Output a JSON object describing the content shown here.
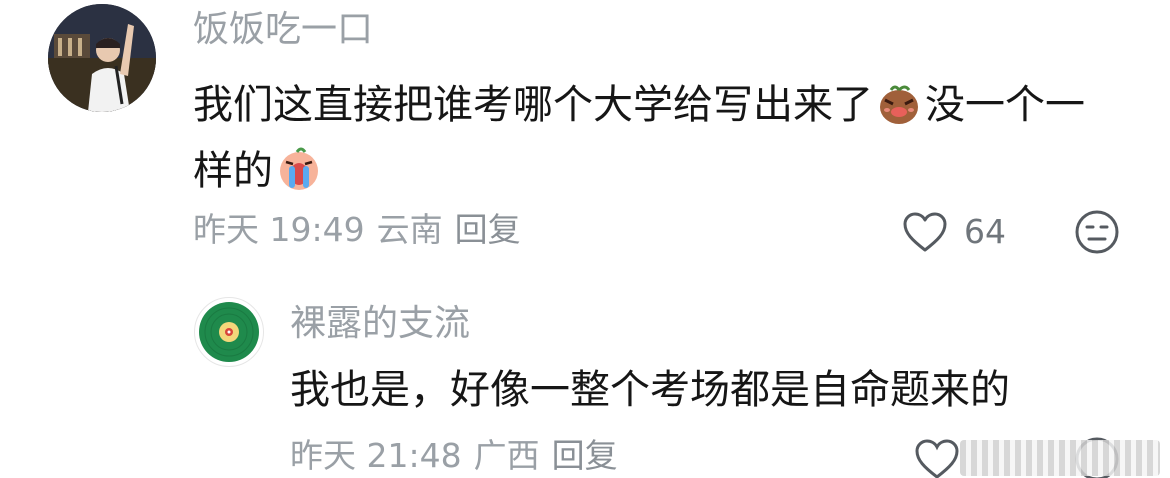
{
  "comment": {
    "username": "饭饭吃一口",
    "text_part1": "我们这直接把谁考哪个大学给写出来了",
    "emoji1": "pig-smirk-emoji",
    "text_part2": "没一个一样的",
    "emoji2": "crying-emoji",
    "time": "昨天 19:49",
    "location": "云南",
    "reply_label": "回复",
    "like_count": "64"
  },
  "reply": {
    "username": "裸露的支流",
    "text": "我也是，好像一整个考场都是自命题来的",
    "time": "昨天 21:48",
    "location": "广西",
    "reply_label": "回复"
  },
  "colors": {
    "text": "#161616",
    "secondary": "#9aa0a6",
    "vinyl_green": "#1f8a4c"
  }
}
